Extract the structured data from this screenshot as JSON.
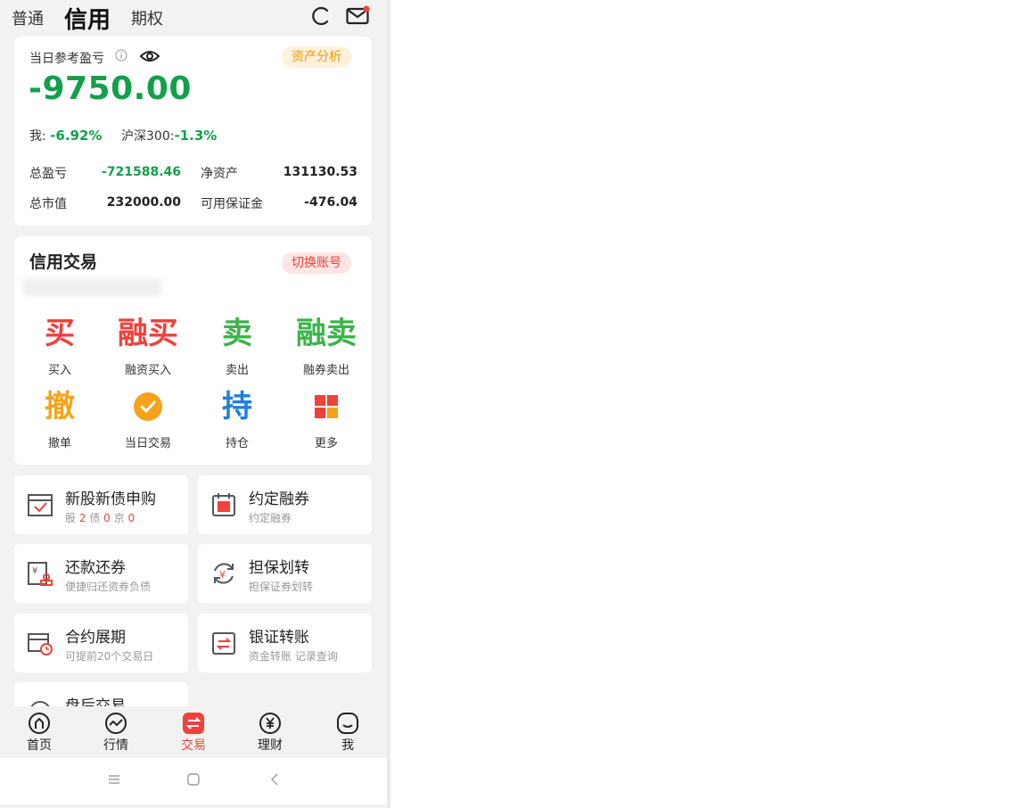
{
  "account_tabs": [
    "普通",
    "信用",
    "期权"
  ],
  "summary": {
    "pnl_label": "当日参考盈亏",
    "analysis_button": "资产分析",
    "pnl_value": "-9750.00",
    "me_label": "我:",
    "me_value": "-6.92%",
    "index_label": "沪深300:",
    "index_value": "-1.3%",
    "total_pnl_label": "总盈亏",
    "total_pnl_value": "-721588.46",
    "net_asset_label": "净资产",
    "net_asset_value": "131130.53",
    "market_value_label": "总市值",
    "market_value_value": "232000.00",
    "margin_label": "可用保证金",
    "margin_value": "-476.04"
  },
  "credit": {
    "title": "信用交易",
    "switch_button": "切换账号",
    "actions": [
      {
        "glyph": "买",
        "label": "买入",
        "color": "#f0413a"
      },
      {
        "glyph": "融买",
        "label": "融资买入",
        "color": "#f0413a"
      },
      {
        "glyph": "卖",
        "label": "卖出",
        "color": "#3ab54a"
      },
      {
        "glyph": "融卖",
        "label": "融券卖出",
        "color": "#3ab54a"
      },
      {
        "glyph": "撤",
        "label": "撤单",
        "color": "#f7a21b"
      },
      {
        "glyph": "check-circle-icon",
        "label": "当日交易",
        "color": "#f7a21b"
      },
      {
        "glyph": "持",
        "label": "持仓",
        "color": "#1d7fe0"
      },
      {
        "glyph": "grid-icon",
        "label": "更多",
        "color": "#f0413a"
      }
    ]
  },
  "tiles": [
    {
      "title": "新股新债申购",
      "sub_parts": [
        "股",
        "2",
        "债",
        "0",
        "京",
        "0"
      ],
      "icon": "calendar-check-icon"
    },
    {
      "title": "约定融券",
      "sub": "约定融券",
      "icon": "calendar-rong-icon"
    },
    {
      "title": "还款还券",
      "sub": "便捷归还资券负债",
      "icon": "repay-icon"
    },
    {
      "title": "担保划转",
      "sub": "担保证券划转",
      "icon": "yuan-transfer-icon"
    },
    {
      "title": "合约展期",
      "sub": "可提前20个交易日",
      "icon": "calendar-clock-icon"
    },
    {
      "title": "银证转账",
      "sub": "资金转账 记录查询",
      "icon": "bank-transfer-icon"
    },
    {
      "title": "盘后交易",
      "sub": "",
      "icon": "after-hours-icon"
    }
  ],
  "nav": [
    "首页",
    "行情",
    "交易",
    "理财",
    "我"
  ],
  "colors": {
    "accent_red": "#f0413a",
    "gain_green": "#12a04a",
    "orange": "#f39800"
  }
}
